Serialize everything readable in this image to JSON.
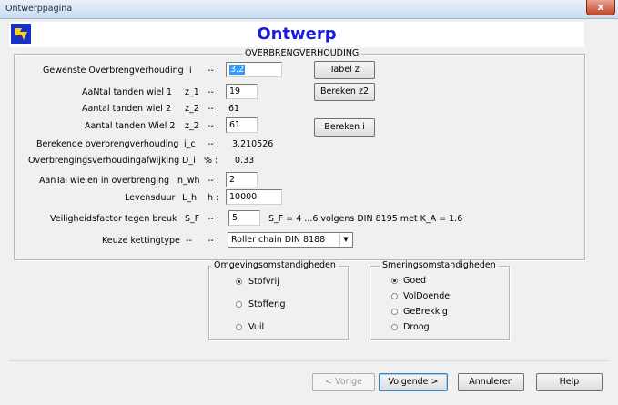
{
  "window": {
    "title": "Ontwerppagina",
    "close": "x"
  },
  "header": {
    "title": "Ontwerp"
  },
  "group_main": {
    "legend": "OVERBRENGVERHOUDING"
  },
  "rows": {
    "gewenste": {
      "label": "Gewenste Overbrengverhouding",
      "sym": "i",
      "sep": "-- :",
      "value": "3.2"
    },
    "aantal1": {
      "label": "AaNtal tanden wiel 1",
      "sym": "z_1",
      "sep": "-- :",
      "value": "19"
    },
    "aantal2a": {
      "label": "Aantal tanden wiel 2",
      "sym": "z_2",
      "sep": "-- :",
      "value": "61"
    },
    "aantal2b": {
      "label": "Aantal tanden Wiel 2",
      "sym": "z_2",
      "sep": "-- :",
      "value": "61"
    },
    "berekende": {
      "label": "Berekende overbrengverhouding",
      "sym": "i_c",
      "sep": "-- :",
      "value": "3.210526"
    },
    "afwijking": {
      "label": "Overbrengingsverhoudingafwijking",
      "sym": "D_i",
      "sep": "% :",
      "value": "0.33"
    },
    "wielen": {
      "label": "AanTal wielen in overbrenging",
      "sym": "n_wh",
      "sep": "-- :",
      "value": "2"
    },
    "levensduur": {
      "label": "Levensduur",
      "sym": "L_h",
      "sep": "h :",
      "value": "10000"
    },
    "veiligheid": {
      "label": "Veiligheidsfactor tegen breuk",
      "sym": "S_F",
      "sep": "-- :",
      "value": "5",
      "note": "S_F = 4 ...6  volgens DIN 8195 met K_A = 1.6"
    },
    "keuze": {
      "label": "Keuze kettingtype",
      "sym": "--",
      "sep": "-- :",
      "value": "Roller chain DIN 8188"
    }
  },
  "buttons": {
    "tabel": "Tabel z",
    "berekenz2": "Bereken z2",
    "bereken_i": "Bereken i",
    "vorige": "< Vorige",
    "volgende": "Volgende >",
    "annuleren": "Annuleren",
    "help": "Help"
  },
  "omgeving": {
    "legend": "Omgevingsomstandigheden",
    "options": [
      "Stofvrij",
      "Stofferig",
      "Vuil"
    ],
    "selected": 0
  },
  "smering": {
    "legend": "Smeringsomstandigheden",
    "options": [
      "Goed",
      "VolDoende",
      "GeBrekkig",
      "Droog"
    ],
    "selected": 0
  }
}
